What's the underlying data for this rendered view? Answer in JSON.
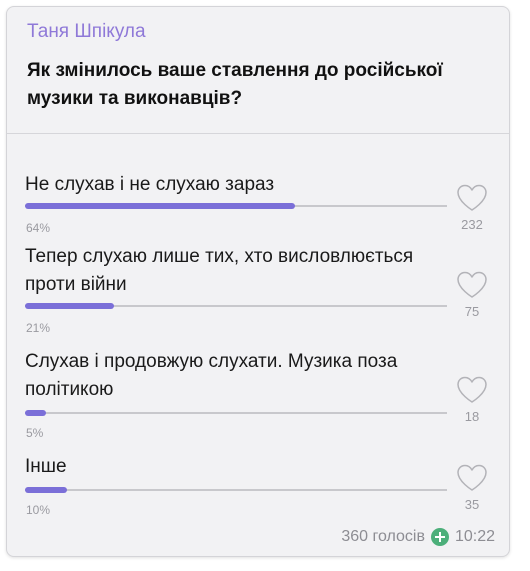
{
  "post": {
    "author": "Таня Шпікула",
    "question": "Як змінилось ваше ставлення до російської музики та виконавців?"
  },
  "options": [
    {
      "text": "Не слухав і не слухаю зараз",
      "percent_label": "64%",
      "percent": 64,
      "likes": "232"
    },
    {
      "text": "Тепер слухаю лише тих, хто висловлюється проти війни",
      "percent_label": "21%",
      "percent": 21,
      "likes": "75"
    },
    {
      "text": "Слухав і продовжую слухати. Музика поза політикою",
      "percent_label": "5%",
      "percent": 5,
      "likes": "18"
    },
    {
      "text": "Інше",
      "percent_label": "10%",
      "percent": 10,
      "likes": "35"
    }
  ],
  "footer": {
    "votes": "360 голосів",
    "time": "10:22"
  },
  "colors": {
    "accent": "#7b6fd8",
    "author": "#8f79d8",
    "status": "#4caf7a"
  },
  "icons": {
    "like": "heart-icon",
    "status": "plus-circle-icon"
  }
}
